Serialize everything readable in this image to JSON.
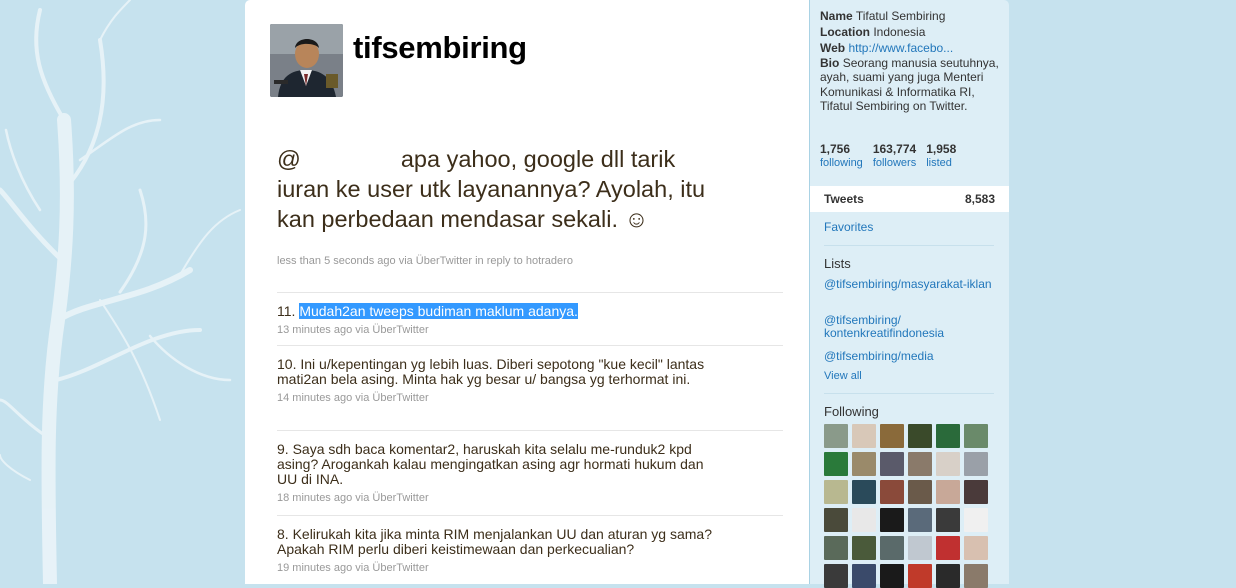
{
  "header": {
    "screen_name": "tifsembiring"
  },
  "latest_tweet": {
    "mention_prefix": "@",
    "text": "apa yahoo, google dll tarik iuran ke user utk layanannya? Ayolah, itu kan perbedaan mendasar sekali. ☺",
    "meta": "less than 5 seconds ago via ÜberTwitter in reply to hotradero"
  },
  "timeline": [
    {
      "text": "11. ",
      "highlighted": "Mudah2an tweeps budiman maklum adanya.",
      "meta": "13 minutes ago via ÜberTwitter"
    },
    {
      "text": "10. Ini u/kepentingan yg lebih luas. Diberi sepotong \"kue kecil\" lantas mati2an bela asing. Minta hak yg besar u/ bangsa yg terhormat ini.",
      "meta": "14 minutes ago via ÜberTwitter"
    },
    {
      "text": "9. Saya sdh baca komentar2, haruskah kita selalu me-runduk2 kpd asing? Arogankah kalau mengingatkan asing agr hormati hukum dan UU di INA.",
      "meta": "18 minutes ago via ÜberTwitter"
    },
    {
      "text": "8. Kelirukah kita jika minta RIM menjalankan UU dan aturan yg sama? Apakah RIM perlu diberi keistimewaan dan perkecualian?",
      "meta": "19 minutes ago via ÜberTwitter"
    }
  ],
  "profile": {
    "name_label": "Name",
    "name": "Tifatul Sembiring",
    "location_label": "Location",
    "location": "Indonesia",
    "web_label": "Web",
    "web": "http://www.facebo...",
    "bio_label": "Bio",
    "bio": "Seorang manusia seutuhnya, ayah, suami yang juga Menteri Komunikasi & Informatika RI, Tifatul Sembiring on Twitter."
  },
  "stats": {
    "following": {
      "count": "1,756",
      "label": "following"
    },
    "followers": {
      "count": "163,774",
      "label": "followers"
    },
    "listed": {
      "count": "1,958",
      "label": "listed"
    }
  },
  "sidebar": {
    "tweets_label": "Tweets",
    "tweets_count": "8,583",
    "favorites_label": "Favorites",
    "lists_heading": "Lists",
    "lists": [
      "@tifsembiring/masyarakat-iklan",
      "@tifsembiring/ kontenkreatifindonesia",
      "@tifsembiring/media"
    ],
    "view_all": "View all",
    "following_heading": "Following"
  },
  "colors": {
    "background": "#c6e2ee",
    "sidebar": "#ddeef6",
    "link": "#2277bb",
    "tweet_text": "#3c2e1a",
    "highlight": "#3399ff"
  },
  "following_avatars": [
    "#8a9a8a",
    "#d8c8b8",
    "#8a6a3a",
    "#3a4a2a",
    "#2a6a3a",
    "#6a8a6a",
    "#2a7a3a",
    "#9a8a6a",
    "#5a5a6a",
    "#8a7a6a",
    "#d8d0c8",
    "#9aa0a8",
    "#b8b890",
    "#2a4a5a",
    "#8a4a3a",
    "#6a5a4a",
    "#c8a898",
    "#4a3a3a",
    "#4a4a3a",
    "#e8e8e8",
    "#1a1a1a",
    "#5a6a7a",
    "#3a3a3a",
    "#f0f0f0",
    "#5a6a5a",
    "#4a5a3a",
    "#5a6a6a",
    "#c0c8d0",
    "#c03030",
    "#d8c0b0",
    "#3a3a3a",
    "#3a4a6a",
    "#1a1a1a",
    "#c03a2a",
    "#2a2a2a",
    "#8a7a6a"
  ]
}
